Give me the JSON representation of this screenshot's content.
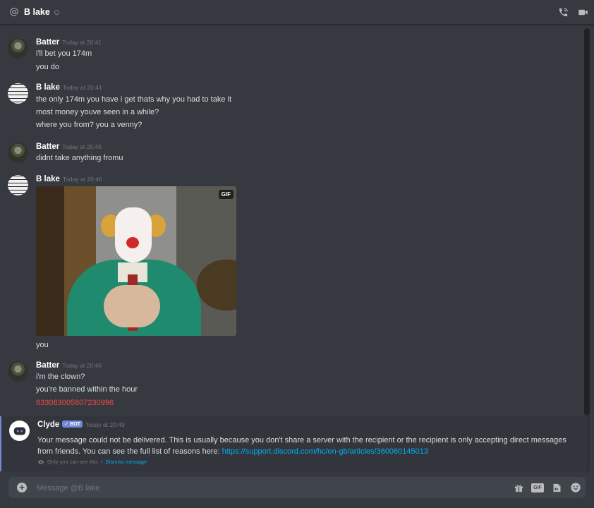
{
  "header": {
    "title": "B lake"
  },
  "messages": [
    {
      "author": "Batter",
      "timestamp": "Today at 20:41",
      "lines": [
        "i'll bet you 174m",
        "you do"
      ]
    },
    {
      "author": "B lake",
      "timestamp": "Today at 20:41",
      "lines": [
        "the only 174m you have i get thats why you had to take it",
        "most money youve seen in a while?",
        "where you from? you a venny?"
      ]
    },
    {
      "author": "Batter",
      "timestamp": "Today at 20:45",
      "lines": [
        "didnt take anything fromu"
      ]
    },
    {
      "author": "B lake",
      "timestamp": "Today at 20:46",
      "gif_badge": "GIF",
      "lines": [
        "you"
      ]
    },
    {
      "author": "Batter",
      "timestamp": "Today at 20:46",
      "lines": [
        "i'm the clown?",
        "you're banned within the hour",
        "833083005807230996"
      ]
    }
  ],
  "bot_message": {
    "author": "Clyde",
    "tag": "✓ BOT",
    "timestamp": "Today at 20:49",
    "text": "Your message could not be delivered. This is usually because you don't share a server with the recipient or the recipient is only accepting direct messages from friends. You can see the full list of reasons here: ",
    "link": "https://support.discord.com/hc/en-gb/articles/360060145013",
    "ephemeral_note": "Only you can see this",
    "separator": "•",
    "dismiss": "Dismiss message"
  },
  "composer": {
    "placeholder": "Message @B lake",
    "gif_label": "GIF"
  },
  "colors": {
    "background": "#36393f",
    "accent": "#7289da",
    "link": "#00b0f4",
    "danger": "#f04747"
  }
}
